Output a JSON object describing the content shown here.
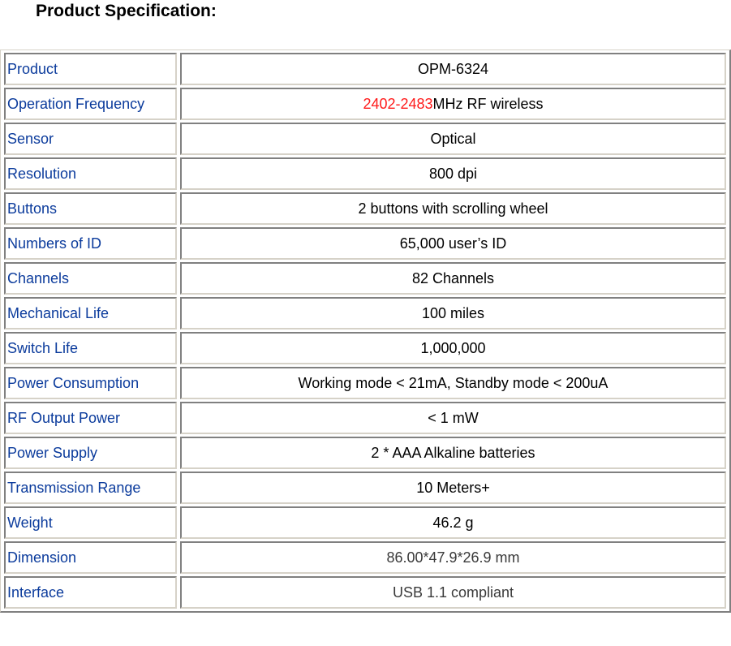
{
  "title": "Product Specification:",
  "colors": {
    "label_text": "#0b3b9c",
    "value_text": "#000000",
    "muted_value_text": "#3a3a3a",
    "highlight": "#ff1a1a"
  },
  "rows": [
    {
      "label": "Product",
      "value": "OPM-6324"
    },
    {
      "label": "Operation Frequency",
      "value_highlight": "2402-2483",
      "value": "MHz RF wireless"
    },
    {
      "label": "Sensor",
      "value": "Optical"
    },
    {
      "label": "Resolution",
      "value": "800 dpi"
    },
    {
      "label": "Buttons",
      "value": "2 buttons with scrolling wheel"
    },
    {
      "label": "Numbers of ID",
      "value": "65,000 user’s ID"
    },
    {
      "label": "Channels",
      "value": "82 Channels"
    },
    {
      "label": "Mechanical Life",
      "value": "100 miles"
    },
    {
      "label": "Switch Life",
      "value": "1,000,000"
    },
    {
      "label": "Power Consumption",
      "value": "Working mode < 21mA, Standby mode < 200uA"
    },
    {
      "label": "RF Output Power",
      "value": "< 1 mW"
    },
    {
      "label": "Power Supply",
      "value": "2 * AAA Alkaline batteries"
    },
    {
      "label": "Transmission Range",
      "value": "10 Meters+"
    },
    {
      "label": "Weight",
      "value": "46.2 g"
    },
    {
      "label": "Dimension",
      "value": "86.00*47.9*26.9 mm"
    },
    {
      "label": "Interface",
      "value": "USB 1.1 compliant"
    }
  ]
}
